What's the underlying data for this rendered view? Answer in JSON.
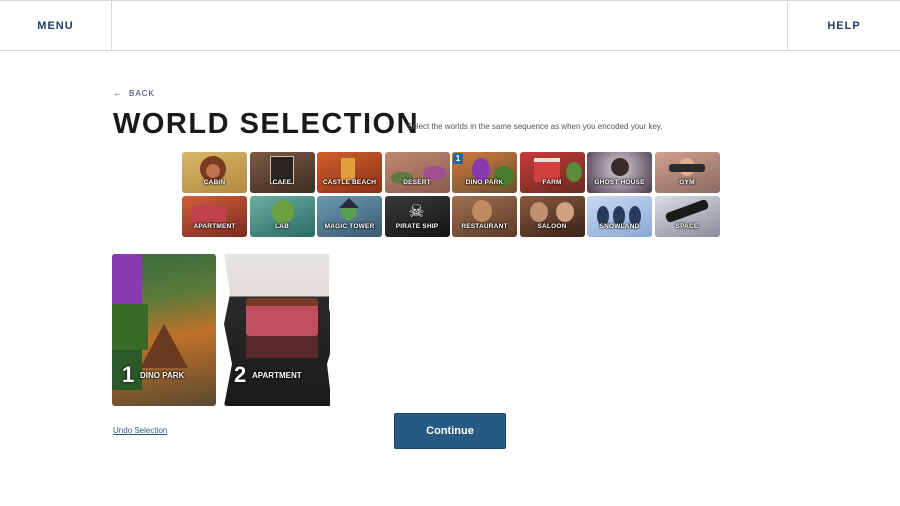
{
  "header": {
    "menu_label": "MENU",
    "help_label": "HELP"
  },
  "nav": {
    "back_label": "BACK",
    "back_icon": "arrow-left-icon"
  },
  "page": {
    "title": "WORLD SELECTION",
    "instructions": "Select the worlds in the same sequence as when you encoded your key."
  },
  "worlds": [
    {
      "label": "CABIN",
      "bg": "#c9a85a"
    },
    {
      "label": "CAFE",
      "bg": "#6a5040"
    },
    {
      "label": "CASTLE BEACH",
      "bg": "#b4502a"
    },
    {
      "label": "DESERT",
      "bg": "#a07050"
    },
    {
      "label": "DINO PARK",
      "bg": "#b86a40",
      "order": "1"
    },
    {
      "label": "FARM",
      "bg": "#b23a3a"
    },
    {
      "label": "GHOST HOUSE",
      "bg": "#6a5a6a"
    },
    {
      "label": "GYM",
      "bg": "#b89080"
    },
    {
      "label": "APARTMENT",
      "bg": "#b04a3a"
    },
    {
      "label": "LAB",
      "bg": "#4a9088"
    },
    {
      "label": "MAGIC TOWER",
      "bg": "#4a7a90"
    },
    {
      "label": "PIRATE SHIP",
      "bg": "#2a2a2a"
    },
    {
      "label": "RESTAURANT",
      "bg": "#8a6040"
    },
    {
      "label": "SALOON",
      "bg": "#6a4030"
    },
    {
      "label": "SNOWLAND",
      "bg": "#a8c0e0"
    },
    {
      "label": "SPACE",
      "bg": "#b8bcc8"
    }
  ],
  "selections": [
    {
      "number": "1",
      "label": "DINO PARK"
    },
    {
      "number": "2",
      "label": "APARTMENT"
    }
  ],
  "actions": {
    "undo_label": "Undo Selection",
    "continue_label": "Continue"
  },
  "colors": {
    "primary": "#265a82",
    "nav_text": "#1f3b5c"
  }
}
